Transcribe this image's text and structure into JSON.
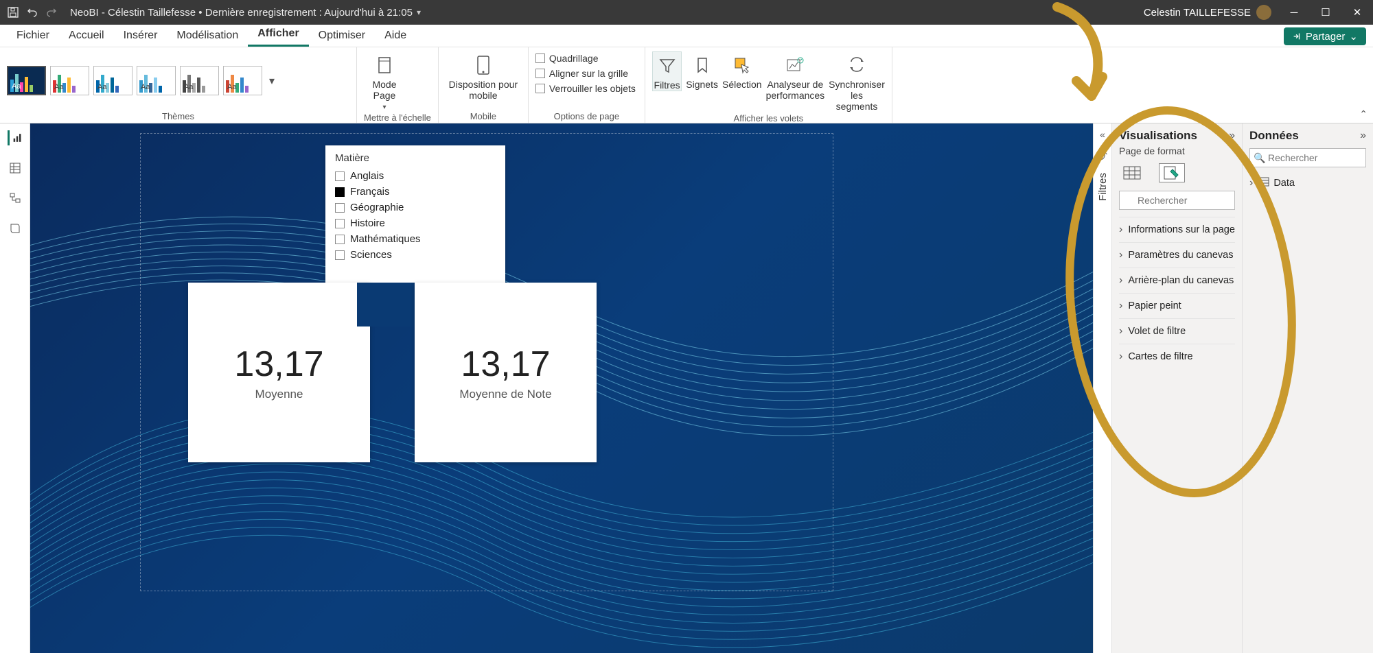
{
  "titlebar": {
    "title": "NeoBI - Célestin Taillefesse • Dernière enregistrement : Aujourd'hui à 21:05",
    "user": "Celestin TAILLEFESSE"
  },
  "tabs": {
    "fichier": "Fichier",
    "accueil": "Accueil",
    "inserer": "Insérer",
    "modelisation": "Modélisation",
    "afficher": "Afficher",
    "optimiser": "Optimiser",
    "aide": "Aide"
  },
  "share": "Partager",
  "ribbon": {
    "themes_label": "Thèmes",
    "mettre_echelle": "Mettre à l'échelle",
    "mode_page": "Mode Page",
    "mobile_label": "Mobile",
    "disposition_mobile": "Disposition pour mobile",
    "options_page": "Options de page",
    "quadrillage": "Quadrillage",
    "aligner": "Aligner sur la grille",
    "verrouiller": "Verrouiller les objets",
    "afficher_volets": "Afficher les volets",
    "filtres": "Filtres",
    "signets": "Signets",
    "selection": "Sélection",
    "analyseur": "Analyseur de performances",
    "sync": "Synchroniser les segments"
  },
  "slicer": {
    "title": "Matière",
    "items": [
      {
        "label": "Anglais",
        "checked": false
      },
      {
        "label": "Français",
        "checked": true
      },
      {
        "label": "Géographie",
        "checked": false
      },
      {
        "label": "Histoire",
        "checked": false
      },
      {
        "label": "Mathématiques",
        "checked": false
      },
      {
        "label": "Sciences",
        "checked": false
      }
    ]
  },
  "kpi1": {
    "value": "13,17",
    "label": "Moyenne"
  },
  "kpi2": {
    "value": "13,17",
    "label": "Moyenne de Note"
  },
  "filters_tab": "Filtres",
  "viz": {
    "title": "Visualisations",
    "subtitle": "Page de format",
    "search_placeholder": "Rechercher",
    "rows": [
      "Informations sur la page",
      "Paramètres du canevas",
      "Arrière-plan du canevas",
      "Papier peint",
      "Volet de filtre",
      "Cartes de filtre"
    ]
  },
  "data": {
    "title": "Données",
    "search_placeholder": "Rechercher",
    "item": "Data"
  }
}
